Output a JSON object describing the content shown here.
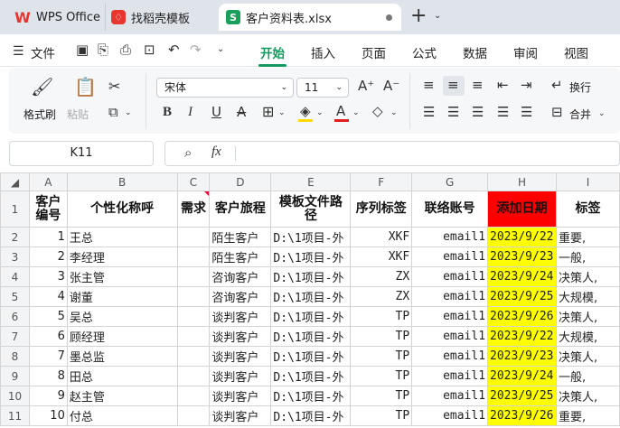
{
  "tabs": [
    {
      "label": "WPS Office",
      "icon": "wps-logo-icon"
    },
    {
      "label": "找稻壳模板",
      "icon": "docer-icon"
    },
    {
      "label": "客户资料表.xlsx",
      "icon": "spreadsheet-s-icon",
      "glyph": "S",
      "active": true
    }
  ],
  "menu": {
    "file": "文件",
    "items": [
      "开始",
      "插入",
      "页面",
      "公式",
      "数据",
      "审阅",
      "视图"
    ],
    "active": "开始"
  },
  "ribbon": {
    "format_painter": "格式刷",
    "paste": "粘贴",
    "font_name": "宋体",
    "font_size": "11",
    "wrap": "换行",
    "merge": "合并"
  },
  "formula": {
    "cell_ref": "K11",
    "fx": "fx",
    "value": ""
  },
  "sheet": {
    "columns": [
      "A",
      "B",
      "C",
      "D",
      "E",
      "F",
      "G",
      "H",
      "I"
    ],
    "headers": [
      "客户编号",
      "个性化称呼",
      "需求",
      "客户旅程",
      "模板文件路径",
      "序列标签",
      "联络账号",
      "添加日期",
      "标签"
    ],
    "rows": [
      {
        "row": "2",
        "id": "1",
        "name": "王总",
        "stage": "陌生客户",
        "path": "D:\\1项目-外",
        "tag": "XKF",
        "acct": "email1",
        "date": "2023/9/22",
        "label": "重要,"
      },
      {
        "row": "3",
        "id": "2",
        "name": "李经理",
        "stage": "陌生客户",
        "path": "D:\\1项目-外",
        "tag": "XKF",
        "acct": "email1",
        "date": "2023/9/23",
        "label": "一般,"
      },
      {
        "row": "4",
        "id": "3",
        "name": "张主管",
        "stage": "咨询客户",
        "path": "D:\\1项目-外",
        "tag": "ZX",
        "acct": "email1",
        "date": "2023/9/24",
        "label": "决策人,"
      },
      {
        "row": "5",
        "id": "4",
        "name": "谢董",
        "stage": "咨询客户",
        "path": "D:\\1项目-外",
        "tag": "ZX",
        "acct": "email1",
        "date": "2023/9/25",
        "label": "大规模,"
      },
      {
        "row": "6",
        "id": "5",
        "name": "吴总",
        "stage": "谈判客户",
        "path": "D:\\1项目-外",
        "tag": "TP",
        "acct": "email1",
        "date": "2023/9/26",
        "label": "决策人,"
      },
      {
        "row": "7",
        "id": "6",
        "name": "顾经理",
        "stage": "谈判客户",
        "path": "D:\\1项目-外",
        "tag": "TP",
        "acct": "email1",
        "date": "2023/9/22",
        "label": "大规模,"
      },
      {
        "row": "8",
        "id": "7",
        "name": "墨总监",
        "stage": "谈判客户",
        "path": "D:\\1项目-外",
        "tag": "TP",
        "acct": "email1",
        "date": "2023/9/23",
        "label": "决策人,"
      },
      {
        "row": "9",
        "id": "8",
        "name": "田总",
        "stage": "谈判客户",
        "path": "D:\\1项目-外",
        "tag": "TP",
        "acct": "email1",
        "date": "2023/9/24",
        "label": "一般,"
      },
      {
        "row": "10",
        "id": "9",
        "name": "赵主管",
        "stage": "谈判客户",
        "path": "D:\\1项目-外",
        "tag": "TP",
        "acct": "email1",
        "date": "2023/9/25",
        "label": "决策人,"
      },
      {
        "row": "11",
        "id": "10",
        "name": "付总",
        "stage": "谈判客户",
        "path": "D:\\1项目-外",
        "tag": "TP",
        "acct": "email1",
        "date": "2023/9/26",
        "label": "重要,"
      }
    ]
  },
  "colors": {
    "accent_green": "#14995e",
    "date_highlight": "#ffff00",
    "date_header": "#ff0000",
    "wps_red": "#e8352e"
  }
}
